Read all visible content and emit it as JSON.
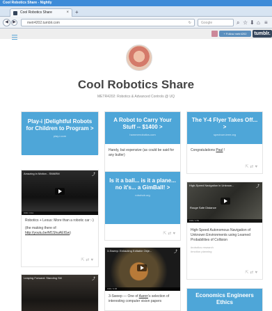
{
  "browser": {
    "window_title": "Cool Robotics Share - Nightly",
    "tab_label": "Cool Robotics Share",
    "url": "metr4202.tumblr.com",
    "search_placeholder": "Google"
  },
  "tumblr_bar": {
    "follow_label": "+ Follow metr4202",
    "tumblr_label": "tumblr."
  },
  "blog": {
    "title": "Cool Robotics Share",
    "description": "METR4202: Robotics & Advanced Controls @ UQ"
  },
  "posts": {
    "p1": {
      "title": "Play-i |Delightful Robots for Children to Program >",
      "url": "play-i.com"
    },
    "p2": {
      "video_title": "Amazing in Motion - SWARM",
      "time": "0:00 / 2:11",
      "text_a": "Robotics + Lexus:  More than a robotic car :-)",
      "text_b": "(the making there of: ",
      "link": "http://youtu.be/M1ShuAElGw",
      "text_c": ")"
    },
    "p3": {
      "video_title": "Leaping Forward: Standing Stil"
    },
    "p4": {
      "title": "A Robot to Carry Your Stuff -- $1400 >",
      "url": "hammerrobotics.com",
      "text": "Handy, but expensive (as could be said for any butler)"
    },
    "p5": {
      "title": "Is it a ball... is it a plane... no it's... a GimBall! >",
      "url": "robohub.org"
    },
    "p6": {
      "video_title": "3-Sweep: Extracting Editable Obje...",
      "time": "0:00 / 2:45",
      "text_a": "3-Sweep — One of ",
      "link": "Aaron",
      "text_b": "'s selection of interesting computer vision papers"
    },
    "p7": {
      "title": "The Y-4 Flyer Takes Off... >",
      "url": "spectrum.ieee.org",
      "text_a": "Congratulations ",
      "link": "Paul",
      "text_b": " !"
    },
    "p8": {
      "video_title": "High-Speed Navigation in Unknow...",
      "overlay_text": "Rouge Safe Distance",
      "time": "0:00 / 1:51",
      "text": "High-Speed Autonomous Navigation of Unknown Environments using Learned Probabilities of Collision",
      "tag1": "#robotics research",
      "tag2": "#motion planning"
    },
    "p9": {
      "title": "Economics Engineers Ethics"
    }
  },
  "colors": {
    "link_blue": "#4ea6d8",
    "tumblr_navy": "#35465c",
    "title_gray": "#444444"
  }
}
